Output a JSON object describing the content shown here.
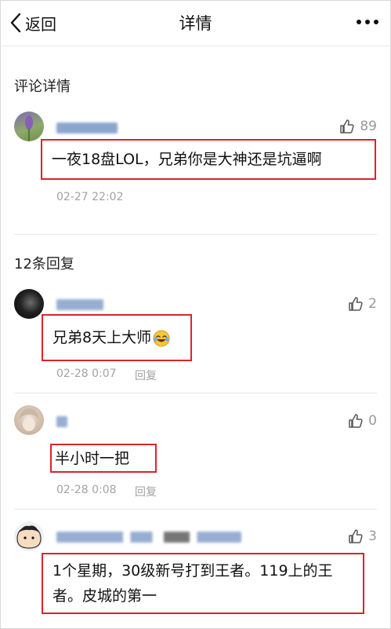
{
  "header": {
    "back_label": "返回",
    "title": "详情"
  },
  "main_comment": {
    "section_title": "评论详情",
    "likes": "89",
    "text": "一夜18盘LOL，兄弟你是大神还是坑逼啊",
    "time": "02-27 22:02"
  },
  "replies": {
    "section_title": "12条回复",
    "reply_label": "回复",
    "items": [
      {
        "likes": "2",
        "text": "兄弟8天上大师",
        "time": "02-28 0:07"
      },
      {
        "likes": "0",
        "text": "半小时一把",
        "time": "02-28 0:08"
      },
      {
        "likes": "3",
        "text_line1": "1个星期，30级新号打到王者。119上的王",
        "text_line2": "者。皮城的第一"
      }
    ]
  },
  "colors": {
    "highlight_border": "#d9252d",
    "meta_gray": "#a2a2a2",
    "username_blur": "#6f8fbf"
  }
}
